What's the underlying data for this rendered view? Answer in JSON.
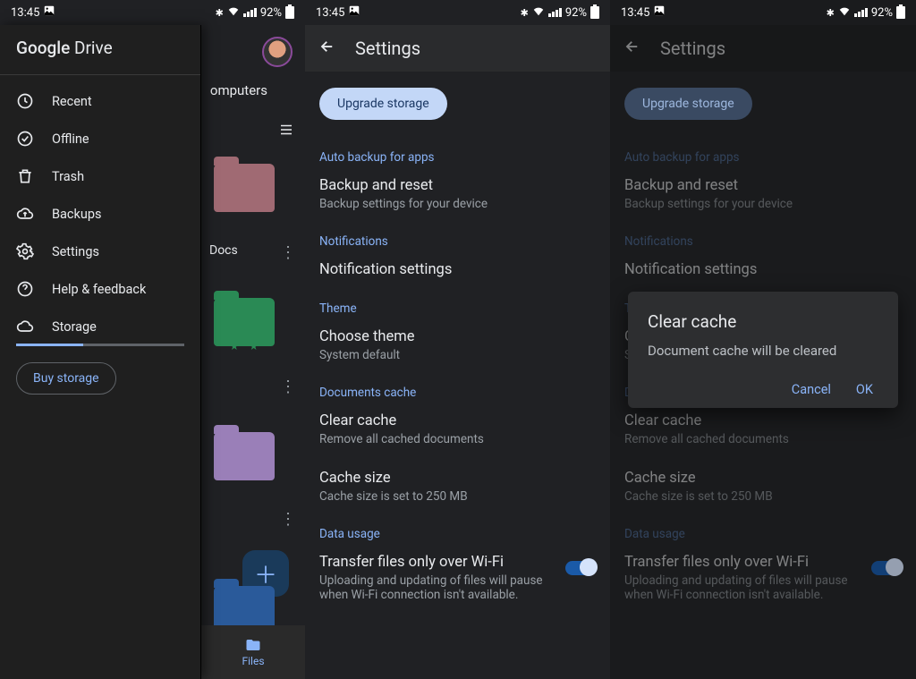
{
  "status": {
    "time": "13:45",
    "battery": "92%"
  },
  "peek": {
    "computers": "omputers",
    "docs": "Docs",
    "files_tab": "Files"
  },
  "drawer": {
    "brand_google": "Google",
    "brand_drive": " Drive",
    "items": {
      "recent": "Recent",
      "offline": "Offline",
      "trash": "Trash",
      "backups": "Backups",
      "settings": "Settings",
      "help": "Help & feedback",
      "storage": "Storage"
    },
    "buy": "Buy storage"
  },
  "settings": {
    "title": "Settings",
    "upgrade": "Upgrade storage",
    "sections": {
      "auto_backup": "Auto backup for apps",
      "notifications": "Notifications",
      "theme": "Theme",
      "doc_cache": "Documents cache",
      "data_usage": "Data usage"
    },
    "rows": {
      "backup_t": "Backup and reset",
      "backup_s": "Backup settings for your device",
      "notif_t": "Notification settings",
      "theme_t": "Choose theme",
      "theme_s": "System default",
      "clear_t": "Clear cache",
      "clear_s": "Remove all cached documents",
      "size_t": "Cache size",
      "size_s": "Cache size is set to 250 MB",
      "wifi_t": "Transfer files only over Wi-Fi",
      "wifi_s": "Uploading and updating of files will pause when Wi-Fi connection isn't available."
    }
  },
  "dialog": {
    "title": "Clear cache",
    "msg": "Document cache will be cleared",
    "cancel": "Cancel",
    "ok": "OK"
  }
}
